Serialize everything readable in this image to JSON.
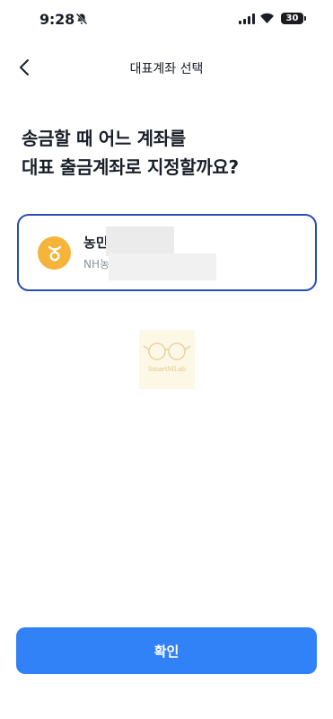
{
  "status_bar": {
    "time": "9:28",
    "battery": "30"
  },
  "nav": {
    "title": "대표계좌 선택"
  },
  "headline": {
    "line1": "송금할 때 어느 계좌를",
    "line2": "대표 출금계좌로 지정할까요?"
  },
  "account": {
    "bank_name": "농민",
    "bank_sub": "NH농",
    "selected": true
  },
  "watermark": {
    "text": "SmartMLab"
  },
  "confirm": {
    "label": "확인"
  },
  "colors": {
    "primary": "#3182f6",
    "card_border": "#2b4eb5",
    "bank_logo": "#f6b43b"
  },
  "icons": {
    "back": "chevron-left-icon",
    "bell": "bell-slash-icon",
    "signal": "cellular-signal-icon",
    "wifi": "wifi-icon",
    "battery": "battery-icon",
    "bank": "nh-bank-logo-icon"
  }
}
